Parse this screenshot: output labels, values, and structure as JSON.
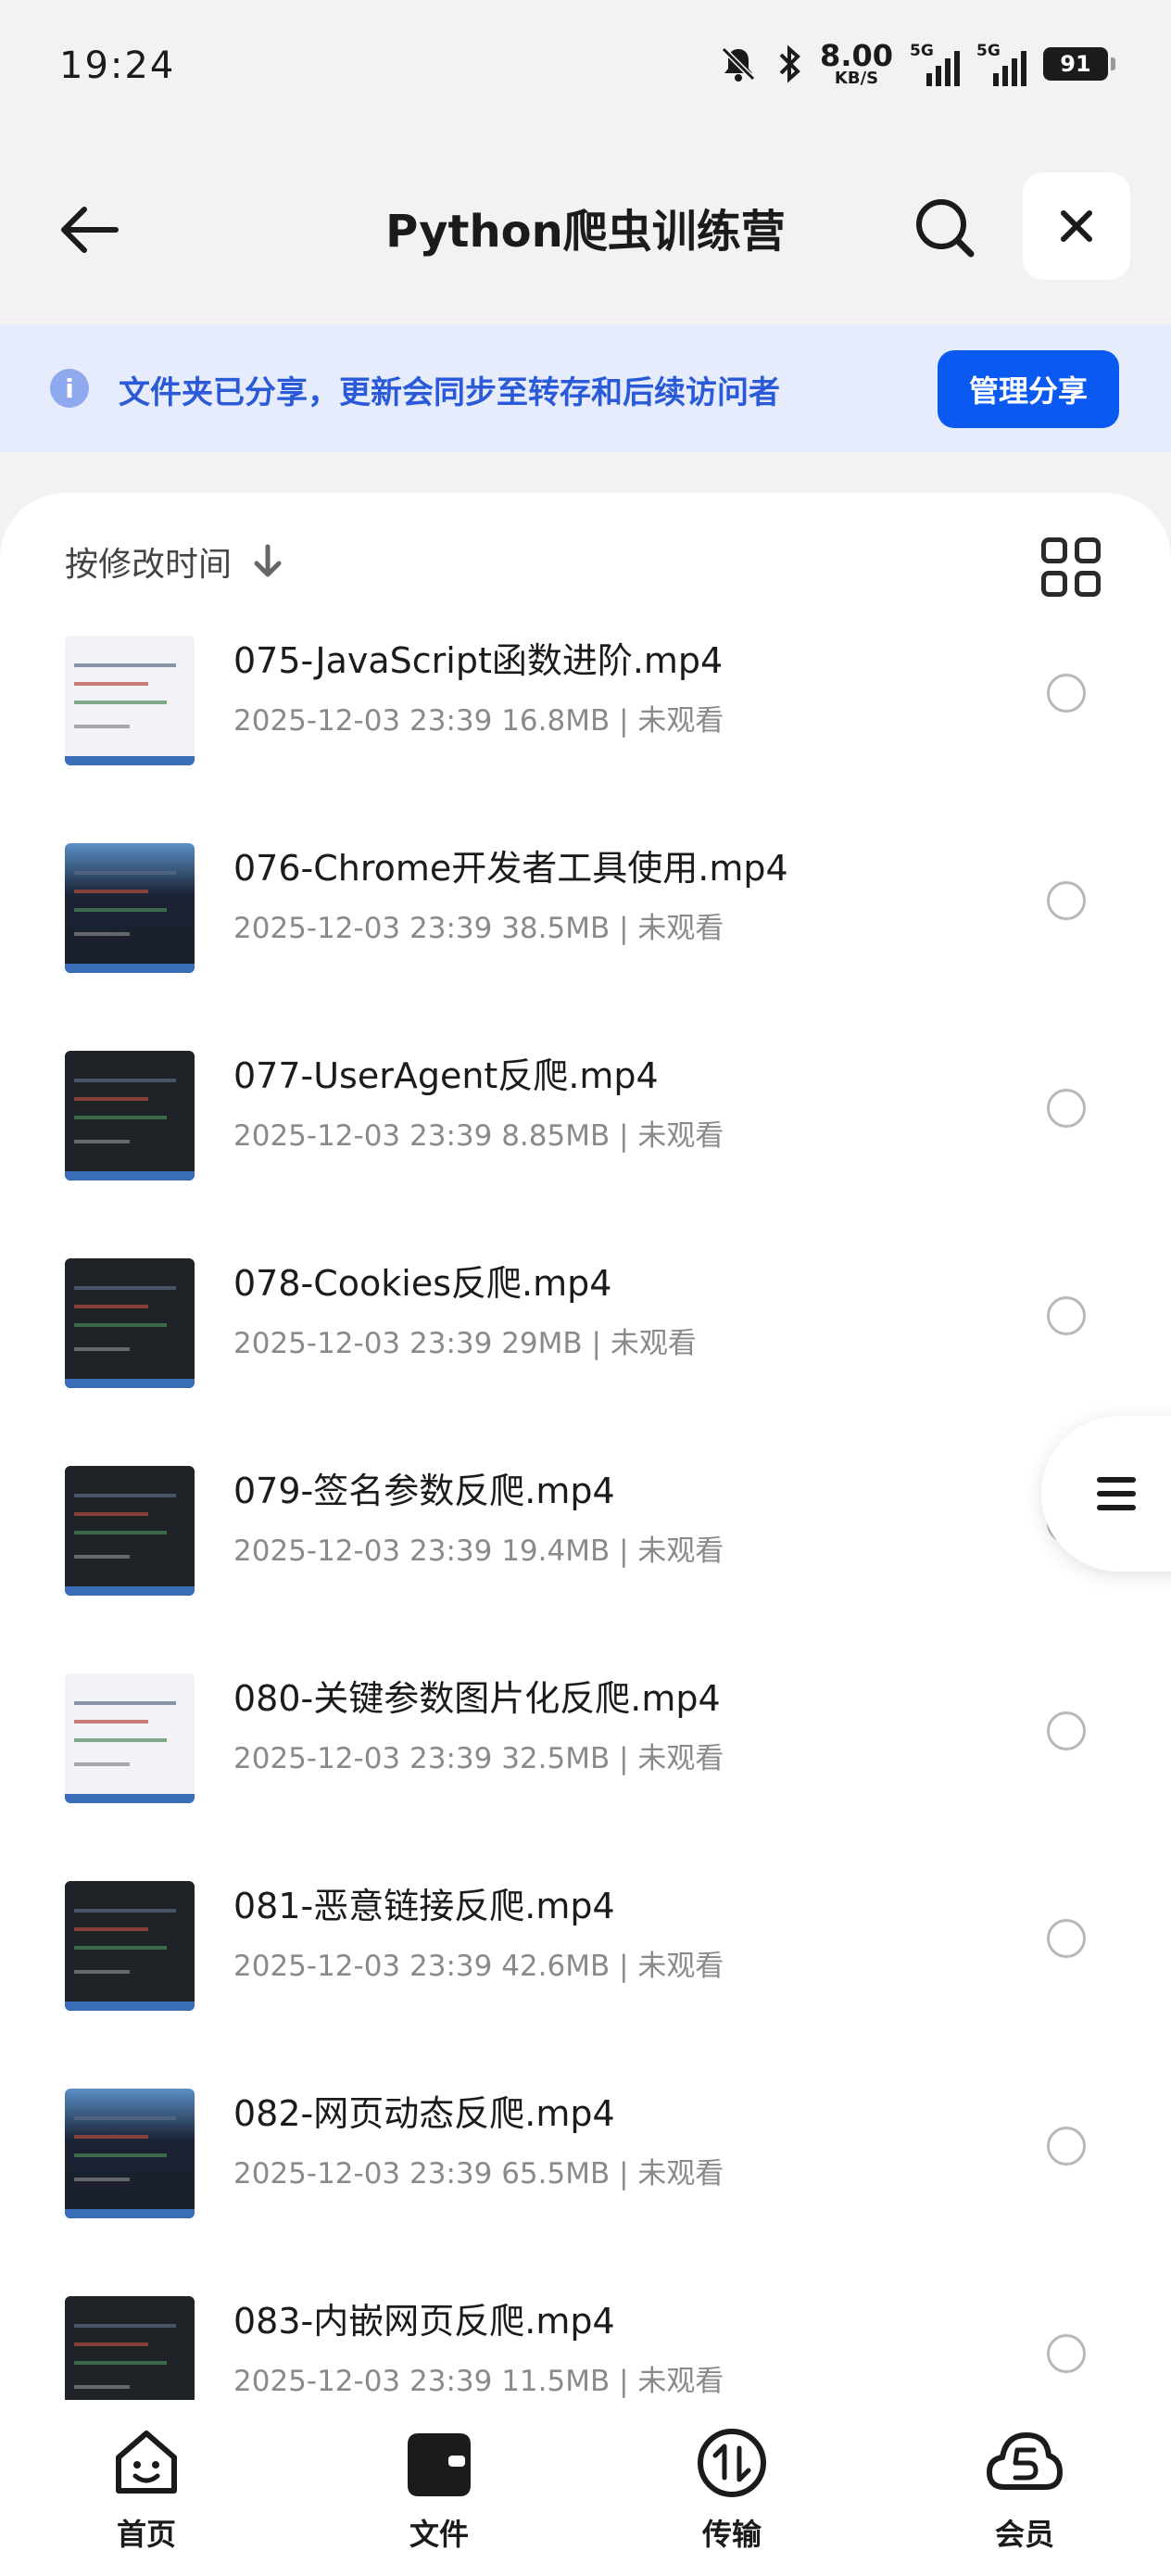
{
  "status_bar": {
    "time": "19:24",
    "net_speed": "8.00",
    "net_unit": "KB/S",
    "sim1": "5G",
    "sim2": "5G",
    "battery": "91"
  },
  "header": {
    "title": "Python爬虫训练营"
  },
  "banner": {
    "message": "文件夹已分享，更新会同步至转存和后续访问者",
    "button": "管理分享"
  },
  "sort": {
    "label": "按修改时间"
  },
  "files": [
    {
      "name": "075-JavaScript函数进阶.mp4",
      "meta": "2025-12-03 23:39  16.8MB | 未观看",
      "thumb": "light"
    },
    {
      "name": "076-Chrome开发者工具使用.mp4",
      "meta": "2025-12-03 23:39  38.5MB | 未观看",
      "thumb": "sky"
    },
    {
      "name": "077-UserAgent反爬.mp4",
      "meta": "2025-12-03 23:39  8.85MB | 未观看",
      "thumb": "dark"
    },
    {
      "name": "078-Cookies反爬.mp4",
      "meta": "2025-12-03 23:39  29MB | 未观看",
      "thumb": "dark"
    },
    {
      "name": "079-签名参数反爬.mp4",
      "meta": "2025-12-03 23:39  19.4MB | 未观看",
      "thumb": "dark"
    },
    {
      "name": "080-关键参数图片化反爬.mp4",
      "meta": "2025-12-03 23:39  32.5MB | 未观看",
      "thumb": "light"
    },
    {
      "name": "081-恶意链接反爬.mp4",
      "meta": "2025-12-03 23:39  42.6MB | 未观看",
      "thumb": "dark"
    },
    {
      "name": "082-网页动态反爬.mp4",
      "meta": "2025-12-03 23:39  65.5MB | 未观看",
      "thumb": "sky"
    },
    {
      "name": "083-内嵌网页反爬.mp4",
      "meta": "2025-12-03 23:39  11.5MB | 未观看",
      "thumb": "dark"
    }
  ],
  "nav": [
    {
      "label": "首页",
      "icon": "home-face-icon"
    },
    {
      "label": "文件",
      "icon": "wallet-folder-icon"
    },
    {
      "label": "传输",
      "icon": "transfer-icon"
    },
    {
      "label": "会员",
      "icon": "membership-cloud-icon"
    }
  ]
}
